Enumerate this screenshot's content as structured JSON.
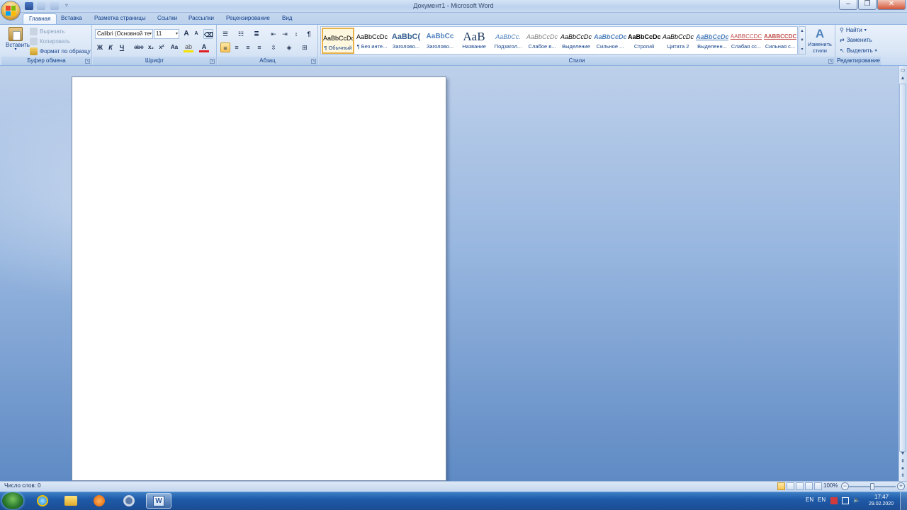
{
  "window": {
    "title": "Документ1 - Microsoft Word"
  },
  "tabs": [
    {
      "label": "Главная",
      "active": true
    },
    {
      "label": "Вставка"
    },
    {
      "label": "Разметка страницы"
    },
    {
      "label": "Ссылки"
    },
    {
      "label": "Рассылки"
    },
    {
      "label": "Рецензирование"
    },
    {
      "label": "Вид"
    }
  ],
  "clipboard": {
    "group_label": "Буфер обмена",
    "paste": "Вставить",
    "cut": "Вырезать",
    "copy": "Копировать",
    "format_painter": "Формат по образцу"
  },
  "font": {
    "group_label": "Шрифт",
    "font_name": "Calibri (Основной те",
    "font_size": "11",
    "bold": "Ж",
    "italic": "К",
    "underline": "Ч",
    "strike": "abe",
    "subscript": "x₂",
    "superscript": "x²",
    "change_case": "Aa",
    "grow": "A",
    "shrink": "A",
    "color_accent": "#e02020",
    "highlight_accent": "#f4e200"
  },
  "paragraph": {
    "group_label": "Абзац",
    "pilcrow": "¶"
  },
  "styles": {
    "group_label": "Стили",
    "change_styles": "Изменить стили",
    "items": [
      {
        "preview": "AaBbCcDc",
        "name": "¶ Обычный",
        "selected": true
      },
      {
        "preview": "AaBbCcDc",
        "name": "¶ Без инте..."
      },
      {
        "preview": "AaBbC(",
        "name": "Заголово..."
      },
      {
        "preview": "AaBbCc",
        "name": "Заголово..."
      },
      {
        "preview": "AaB",
        "name": "Название"
      },
      {
        "preview": "AaBbCc.",
        "name": "Подзагол..."
      },
      {
        "preview": "AaBbCcDc",
        "name": "Слабое в..."
      },
      {
        "preview": "AaBbCcDc",
        "name": "Выделение"
      },
      {
        "preview": "AaBbCcDc",
        "name": "Сильное ..."
      },
      {
        "preview": "AaBbCcDc",
        "name": "Строгий"
      },
      {
        "preview": "AaBbCcDc",
        "name": "Цитата 2"
      },
      {
        "preview": "AaBbCcDc",
        "name": "Выделенн..."
      },
      {
        "preview": "AABBCCDC",
        "name": "Слабая сс..."
      },
      {
        "preview": "AABBCCDC",
        "name": "Сильная с..."
      }
    ]
  },
  "editing": {
    "group_label": "Редактирование",
    "find": "Найти",
    "replace": "Заменить",
    "select": "Выделить"
  },
  "statusbar": {
    "word_count": "Число слов: 0",
    "zoom": "100%"
  },
  "taskbar": {
    "lang1": "EN",
    "lang2": "EN",
    "time": "17:47",
    "date": "29.02.2020"
  }
}
